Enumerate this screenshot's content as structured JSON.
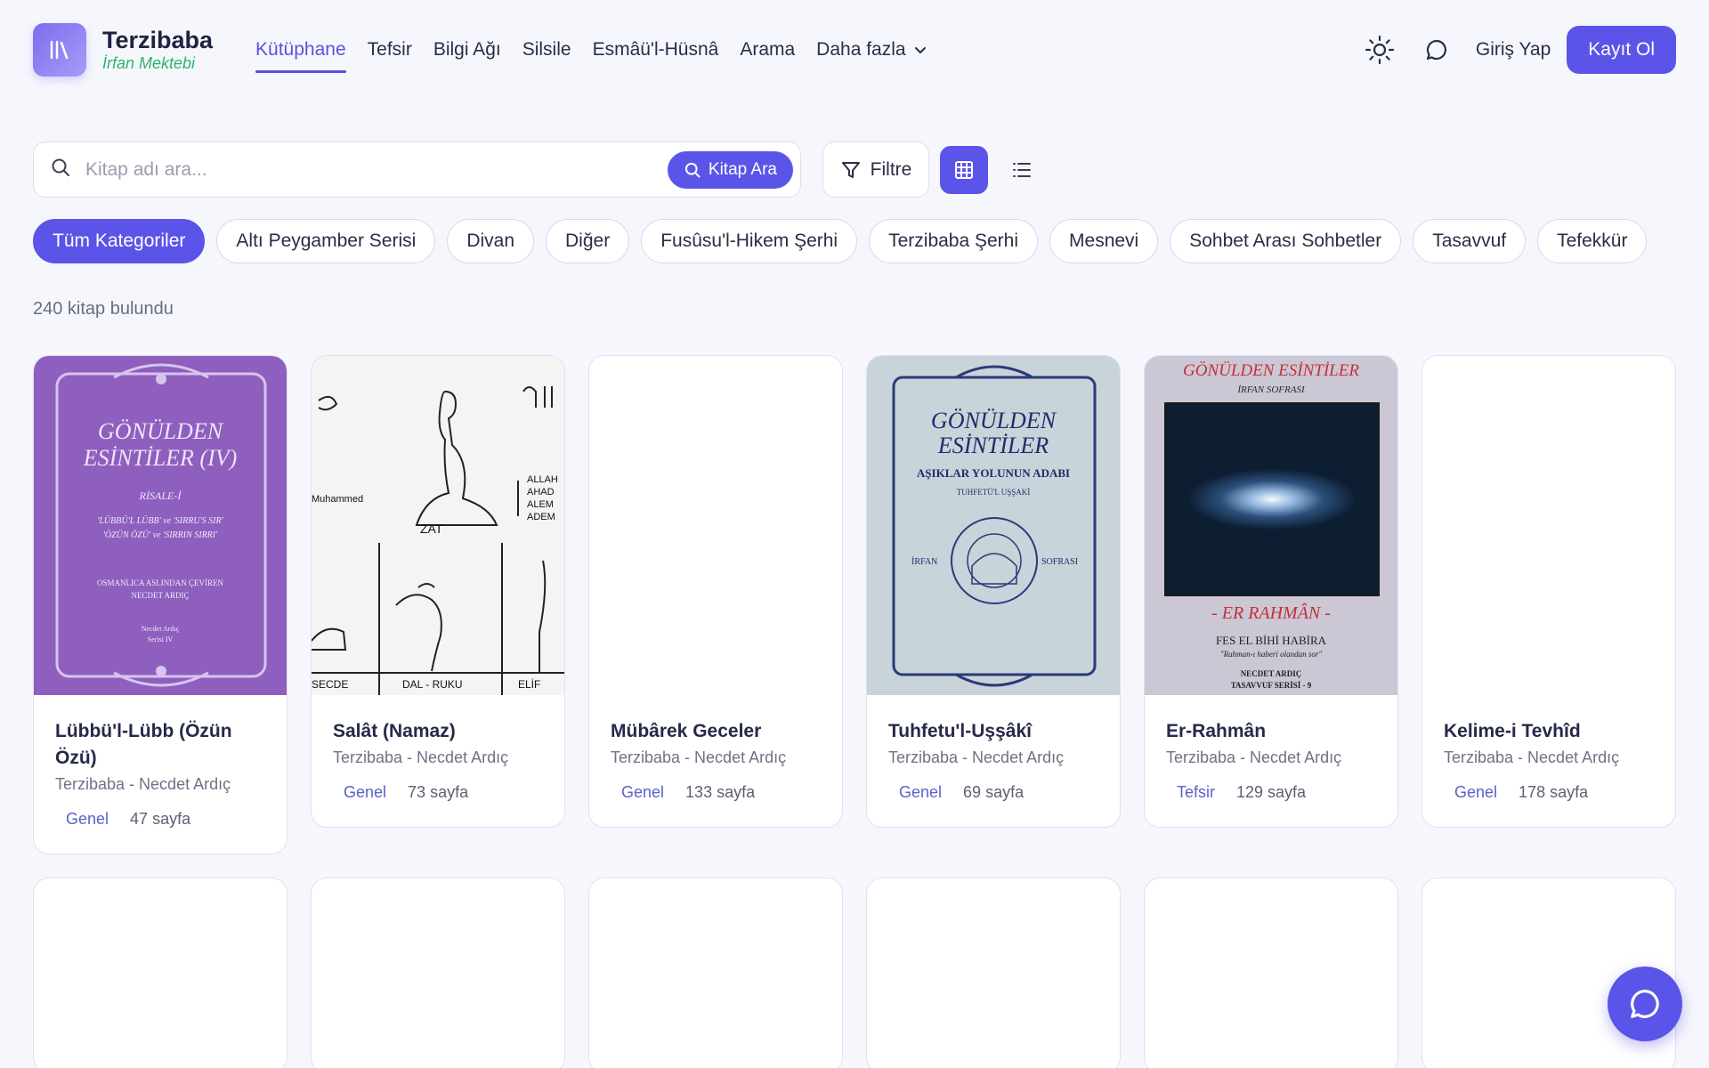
{
  "brand": {
    "name": "Terzibaba",
    "subtitle": "İrfan Mektebi"
  },
  "nav": {
    "items": [
      {
        "label": "Kütüphane",
        "active": true
      },
      {
        "label": "Tefsir"
      },
      {
        "label": "Bilgi Ağı"
      },
      {
        "label": "Silsile"
      },
      {
        "label": "Esmâü'l-Hüsnâ"
      },
      {
        "label": "Arama"
      },
      {
        "label": "Daha fazla"
      }
    ],
    "login": "Giriş Yap",
    "signup": "Kayıt Ol"
  },
  "search": {
    "placeholder": "Kitap adı ara...",
    "button": "Kitap Ara",
    "filter": "Filtre"
  },
  "categories": [
    "Tüm Kategoriler",
    "Altı Peygamber Serisi",
    "Divan",
    "Diğer",
    "Fusûsu'l-Hikem Şerhi",
    "Terzibaba Şerhi",
    "Mesnevi",
    "Sohbet Arası Sohbetler",
    "Tasavvuf",
    "Tefekkür"
  ],
  "result_count": "240 kitap bulundu",
  "books": [
    {
      "title": "Lübbü'l-Lübb (Özün Özü)",
      "author": "Terzibaba - Necdet Ardıç",
      "category": "Genel",
      "pages": "47 sayfa"
    },
    {
      "title": "Salât (Namaz)",
      "author": "Terzibaba - Necdet Ardıç",
      "category": "Genel",
      "pages": "73 sayfa"
    },
    {
      "title": "Mübârek Geceler",
      "author": "Terzibaba - Necdet Ardıç",
      "category": "Genel",
      "pages": "133 sayfa"
    },
    {
      "title": "Tuhfetu'l-Uşşâkî",
      "author": "Terzibaba - Necdet Ardıç",
      "category": "Genel",
      "pages": "69 sayfa"
    },
    {
      "title": "Er-Rahmân",
      "author": "Terzibaba - Necdet Ardıç",
      "category": "Tefsir",
      "pages": "129 sayfa"
    },
    {
      "title": "Kelime-i Tevhîd",
      "author": "Terzibaba - Necdet Ardıç",
      "category": "Genel",
      "pages": "178 sayfa"
    }
  ],
  "covers": {
    "c1": {
      "line1": "GÖNÜLDEN",
      "line2": "ESİNTİLER (IV)",
      "small1": "RİSALE-İ",
      "small2": "'LÜBBÜ'L LÜBB' ve 'SIRRU'S SIR'",
      "small3": "'ÖZÜN ÖZÜ' ve 'SIRRIN SIRRI'",
      "small4": "OSMANLICA ASLINDAN ÇEVİREN",
      "small5": "NECDET ARDIÇ",
      "small6": "Necdet Ardıç",
      "small7": "Serisi IV"
    },
    "c2": {
      "w1": "Muhammed",
      "w2": "ZAT",
      "w3": "ALLAH",
      "w4": "AHAD",
      "w5": "ALEM",
      "w6": "ADEM",
      "w7": "SECDE",
      "w8": "DAL - RUKU",
      "w9": "ELİF"
    },
    "c4": {
      "line1": "GÖNÜLDEN",
      "line2": "ESİNTİLER",
      "sub": "AŞIKLAR YOLUNUN ADABI",
      "s1": "TUHFETÜ'L UŞŞAKİ",
      "s2": "İRFAN",
      "s3": "SOFRASI"
    },
    "c5": {
      "line1": "GÖNÜLDEN ESİNTİLER",
      "line2": "İRFAN SOFRASI",
      "mid": "- ER RAHMÂN -",
      "b1": "FES EL BİHİ HABİRA",
      "b2": "\"Rahman-ı haberi olandan sor\"",
      "b3": "NECDET ARDIÇ",
      "b4": "TASAVVUF SERİSİ - 9"
    }
  },
  "colors": {
    "accent": "#5b54e8",
    "green": "#2fb36a"
  }
}
